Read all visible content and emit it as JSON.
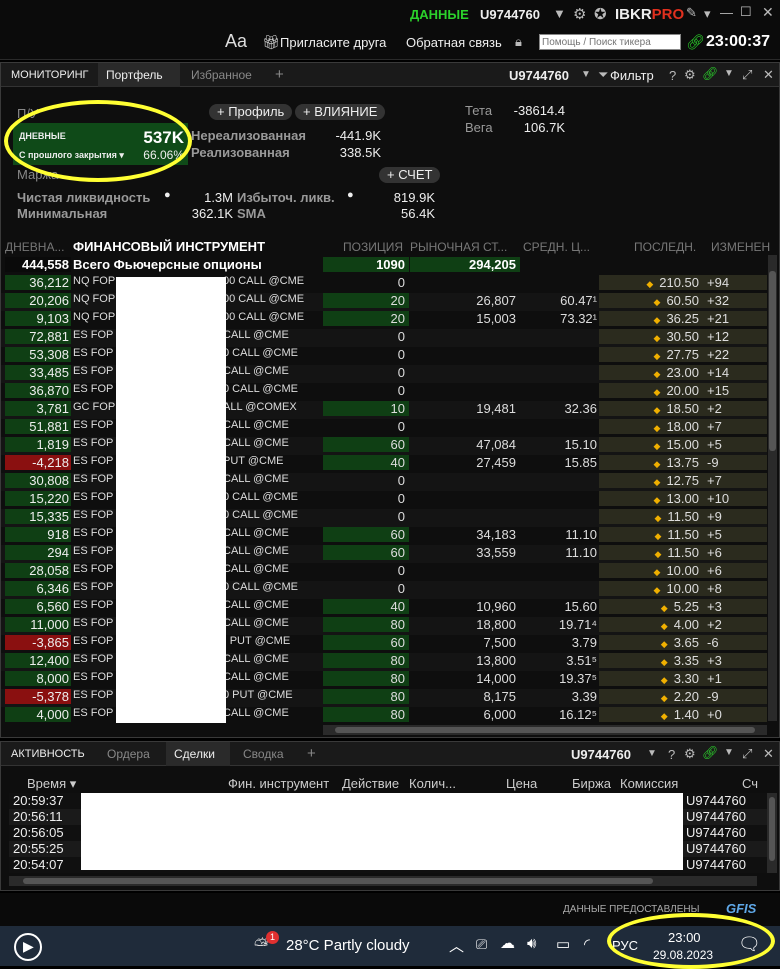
{
  "titlebar": {
    "data_label": "ДАННЫЕ",
    "account": "U9744760",
    "brand_ibkr": "IBKR",
    "brand_pro": "PRO"
  },
  "toolbar": {
    "font_label": "Aa",
    "invite": "Пригласите друга",
    "feedback": "Обратная связь",
    "search_placeholder": "Помощь / Поиск тикера",
    "clock": "23:00:37"
  },
  "panel1": {
    "tabs": [
      "МОНИТОРИНГ",
      "Портфель",
      "Избранное",
      "+"
    ],
    "account": "U9744760",
    "filter": "Фильтр",
    "help": "?",
    "pnl_label": "П/У",
    "profile_btn": "+ Профиль",
    "impact_btn": "+ ВЛИЯНИЕ",
    "daily_label": "ДНЕВНЫЕ",
    "daily_value": "537K",
    "since_close": "С прошлого закрытия ▾",
    "since_close_pct": "66.06%",
    "unrealized_label": "Нереализованная",
    "unrealized_value": "-441.9K",
    "realized_label": "Реализованная",
    "realized_value": "338.5K",
    "theta_label": "Тета",
    "theta_value": "-38614.4",
    "vega_label": "Вега",
    "vega_value": "106.7K",
    "margin_label": "Маржа",
    "account_btn": "+ СЧЕТ",
    "netliq_label": "Чистая ликвидность",
    "netliq_value": "1.3M",
    "excess_label": "Избыточ. ликв.",
    "excess_value": "819.9K",
    "min_label": "Минимальная",
    "min_value": "362.1K",
    "sma_label": "SMA",
    "sma_value": "56.4K",
    "columns": [
      "ДНЕВНА...",
      "ФИНАНСОВЫЙ ИНСТРУМЕНТ",
      "ПОЗИЦИЯ",
      "РЫНОЧНАЯ СТ...",
      "СРЕДН. Ц...",
      "ПОСЛЕДН.",
      "ИЗМЕНЕН"
    ],
    "total": {
      "daily": "444,558",
      "name": "Всего Фьючерсные опционы",
      "position": "1090",
      "market": "294,205"
    },
    "rows": [
      {
        "daily": "36,212",
        "sym": "NQ FOP",
        "tail": "00 CALL @CME",
        "pos": "0",
        "mkt": "",
        "avg": "",
        "last": "210.50",
        "chg": "+94"
      },
      {
        "daily": "20,206",
        "sym": "NQ FOP",
        "tail": "00 CALL @CME",
        "pos": "20",
        "mkt": "26,807",
        "avg": "60.47¹",
        "last": "60.50",
        "chg": "+32"
      },
      {
        "daily": "9,103",
        "sym": "NQ FOP",
        "tail": "00 CALL @CME",
        "pos": "20",
        "mkt": "15,003",
        "avg": "73.32¹",
        "last": "36.25",
        "chg": "+21"
      },
      {
        "daily": "72,881",
        "sym": "ES FOP",
        "tail": "CALL @CME",
        "pos": "0",
        "mkt": "",
        "avg": "",
        "last": "30.50",
        "chg": "+12"
      },
      {
        "daily": "53,308",
        "sym": "ES FOP",
        "tail": "0 CALL @CME",
        "pos": "0",
        "mkt": "",
        "avg": "",
        "last": "27.75",
        "chg": "+22"
      },
      {
        "daily": "33,485",
        "sym": "ES FOP",
        "tail": "CALL @CME",
        "pos": "0",
        "mkt": "",
        "avg": "",
        "last": "23.00",
        "chg": "+14"
      },
      {
        "daily": "36,870",
        "sym": "ES FOP",
        "tail": "0 CALL @CME",
        "pos": "0",
        "mkt": "",
        "avg": "",
        "last": "20.00",
        "chg": "+15"
      },
      {
        "daily": "3,781",
        "sym": "GC FOP",
        "tail": "ALL @COMEX",
        "pos": "10",
        "mkt": "19,481",
        "avg": "32.36",
        "last": "18.50",
        "chg": "+2"
      },
      {
        "daily": "51,881",
        "sym": "ES FOP",
        "tail": "CALL @CME",
        "pos": "0",
        "mkt": "",
        "avg": "",
        "last": "18.00",
        "chg": "+7"
      },
      {
        "daily": "1,819",
        "sym": "ES FOP",
        "tail": "CALL @CME",
        "pos": "60",
        "mkt": "47,084",
        "avg": "15.10",
        "last": "15.00",
        "chg": "+5"
      },
      {
        "daily": "-4,218",
        "sym": "ES FOP",
        "tail": "PUT @CME",
        "pos": "40",
        "mkt": "27,459",
        "avg": "15.85",
        "last": "13.75",
        "chg": "-9",
        "neg": true
      },
      {
        "daily": "30,808",
        "sym": "ES FOP",
        "tail": "CALL @CME",
        "pos": "0",
        "mkt": "",
        "avg": "",
        "last": "12.75",
        "chg": "+7"
      },
      {
        "daily": "15,220",
        "sym": "ES FOP",
        "tail": "0 CALL @CME",
        "pos": "0",
        "mkt": "",
        "avg": "",
        "last": "13.00",
        "chg": "+10"
      },
      {
        "daily": "15,335",
        "sym": "ES FOP",
        "tail": "0 CALL @CME",
        "pos": "0",
        "mkt": "",
        "avg": "",
        "last": "11.50",
        "chg": "+9"
      },
      {
        "daily": "918",
        "sym": "ES FOP",
        "tail": "CALL @CME",
        "pos": "60",
        "mkt": "34,183",
        "avg": "11.10",
        "last": "11.50",
        "chg": "+5"
      },
      {
        "daily": "294",
        "sym": "ES FOP",
        "tail": "CALL @CME",
        "pos": "60",
        "mkt": "33,559",
        "avg": "11.10",
        "last": "11.50",
        "chg": "+6"
      },
      {
        "daily": "28,058",
        "sym": "ES FOP",
        "tail": "CALL @CME",
        "pos": "0",
        "mkt": "",
        "avg": "",
        "last": "10.00",
        "chg": "+6"
      },
      {
        "daily": "6,346",
        "sym": "ES FOP",
        "tail": "0 CALL @CME",
        "pos": "0",
        "mkt": "",
        "avg": "",
        "last": "10.00",
        "chg": "+8"
      },
      {
        "daily": "6,560",
        "sym": "ES FOP",
        "tail": "CALL @CME",
        "pos": "40",
        "mkt": "10,960",
        "avg": "15.60",
        "last": "5.25",
        "chg": "+3"
      },
      {
        "daily": "11,000",
        "sym": "ES FOP",
        "tail": "CALL @CME",
        "pos": "80",
        "mkt": "18,800",
        "avg": "19.71⁴",
        "last": "4.00",
        "chg": "+2"
      },
      {
        "daily": "-3,865",
        "sym": "ES FOP",
        "tail": ") PUT @CME",
        "pos": "60",
        "mkt": "7,500",
        "avg": "3.79",
        "last": "3.65",
        "chg": "-6",
        "neg": true
      },
      {
        "daily": "12,400",
        "sym": "ES FOP",
        "tail": "CALL @CME",
        "pos": "80",
        "mkt": "13,800",
        "avg": "3.51⁵",
        "last": "3.35",
        "chg": "+3"
      },
      {
        "daily": "8,000",
        "sym": "ES FOP",
        "tail": "CALL @CME",
        "pos": "80",
        "mkt": "14,000",
        "avg": "19.37⁵",
        "last": "3.30",
        "chg": "+1"
      },
      {
        "daily": "-5,378",
        "sym": "ES FOP",
        "tail": "0 PUT @CME",
        "pos": "80",
        "mkt": "8,175",
        "avg": "3.39",
        "last": "2.20",
        "chg": "-9",
        "neg": true
      },
      {
        "daily": "4,000",
        "sym": "ES FOP",
        "tail": "CALL @CME",
        "pos": "80",
        "mkt": "6,000",
        "avg": "16.12⁵",
        "last": "1.40",
        "chg": "+0"
      }
    ]
  },
  "panel2": {
    "tabs": [
      "АКТИВНОСТЬ",
      "Ордера",
      "Сделки",
      "Сводка",
      "+"
    ],
    "account": "U9744760",
    "help": "?",
    "columns": [
      "Время ▾",
      "Фин. инструмент",
      "Действие",
      "Колич...",
      "Цена",
      "Биржа",
      "Комиссия",
      "Сч"
    ],
    "trades": [
      {
        "time": "20:59:37",
        "acct": "U9744760"
      },
      {
        "time": "20:56:11",
        "acct": "U9744760"
      },
      {
        "time": "20:56:05",
        "acct": "U9744760"
      },
      {
        "time": "20:55:25",
        "acct": "U9744760"
      },
      {
        "time": "20:54:07",
        "acct": "U9744760"
      }
    ]
  },
  "footer": {
    "data_by": "ДАННЫЕ ПРЕДОСТАВЛЕНЫ",
    "gfis": "GFIS"
  },
  "taskbar": {
    "badge": "1",
    "weather": "28°C  Partly cloudy",
    "lang": "РУС",
    "time": "23:00",
    "date": "29.08.2023"
  },
  "colors": {
    "green_label": "#2bd22b",
    "brand_pro": "#e0301e",
    "positive_bg": "#0f3f14",
    "negative_bg": "#8a1010",
    "highlight_circle": "#ffff33"
  }
}
